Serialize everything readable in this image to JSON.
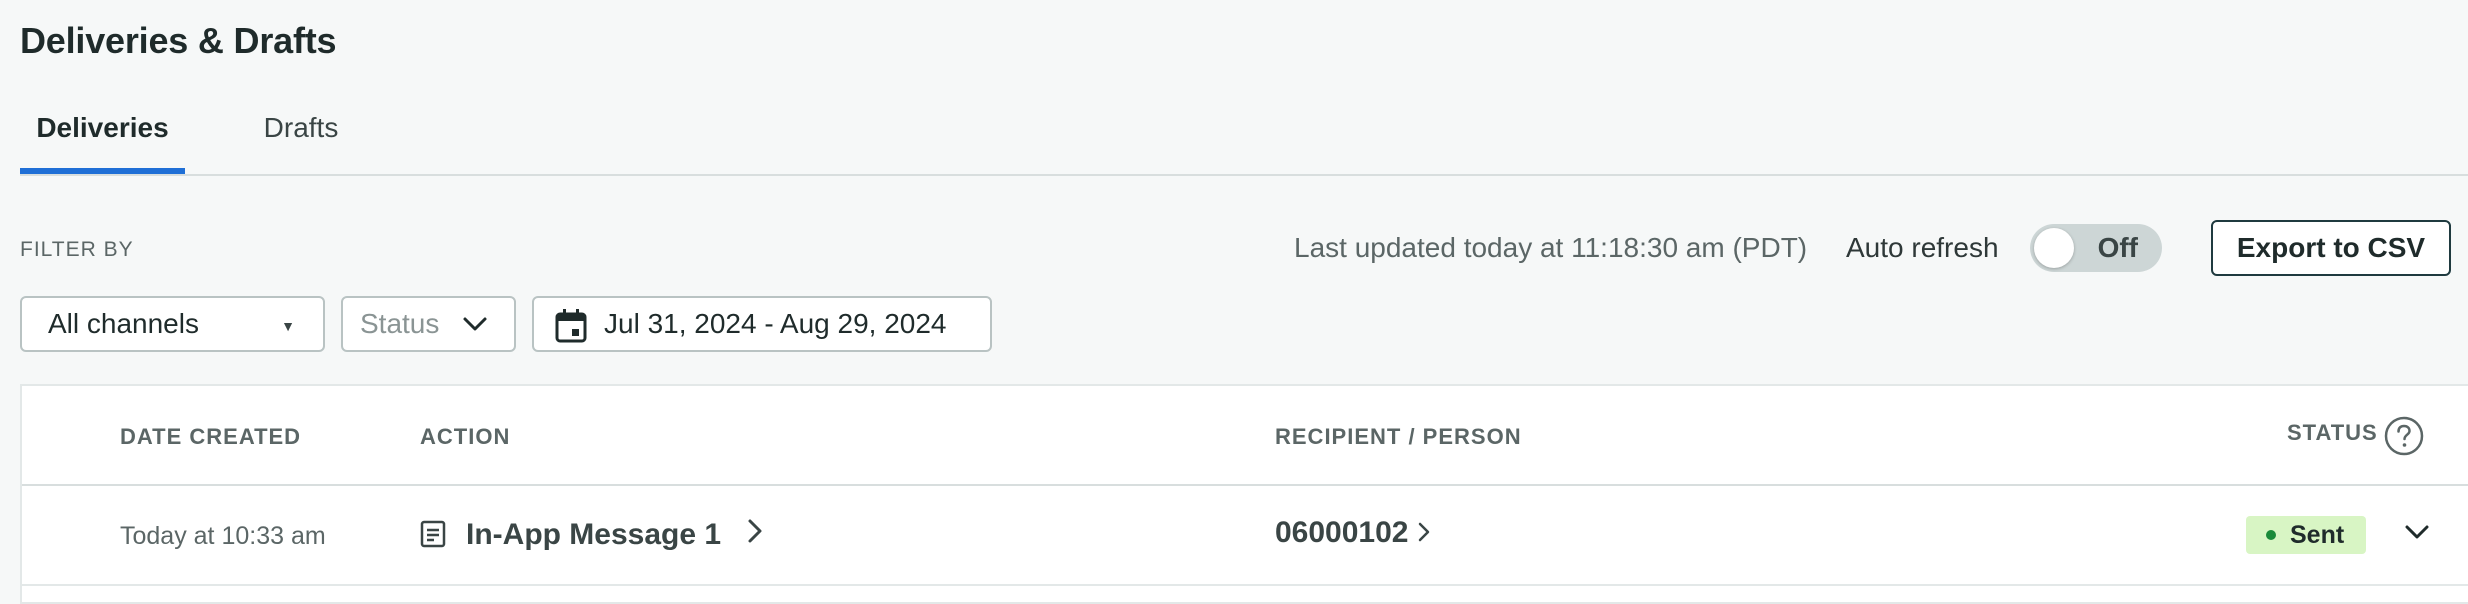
{
  "page": {
    "title": "Deliveries & Drafts"
  },
  "tabs": [
    {
      "label": "Deliveries",
      "active": true
    },
    {
      "label": "Drafts",
      "active": false
    }
  ],
  "filters": {
    "label": "FILTER BY",
    "channels": "All channels",
    "status_placeholder": "Status",
    "date_range": "Jul 31, 2024 - Aug 29, 2024"
  },
  "toolbar": {
    "last_updated": "Last updated today at 11:18:30 am (PDT)",
    "auto_refresh_label": "Auto refresh",
    "auto_refresh_state": "Off",
    "export_label": "Export to CSV"
  },
  "table": {
    "columns": [
      "DATE CREATED",
      "ACTION",
      "RECIPIENT / PERSON",
      "STATUS"
    ],
    "rows": [
      {
        "date": "Today at 10:33 am",
        "action": "In-App Message 1",
        "recipient": "06000102",
        "status": "Sent"
      }
    ]
  },
  "icons": {
    "calendar": "calendar-icon",
    "status_help": "help-circle-icon",
    "action_type": "message-icon",
    "expand": "chevron-down-icon"
  },
  "colors": {
    "accent": "#1f6fd6",
    "sent_badge_bg": "#d8f5c4",
    "sent_dot": "#1a8a3a"
  }
}
